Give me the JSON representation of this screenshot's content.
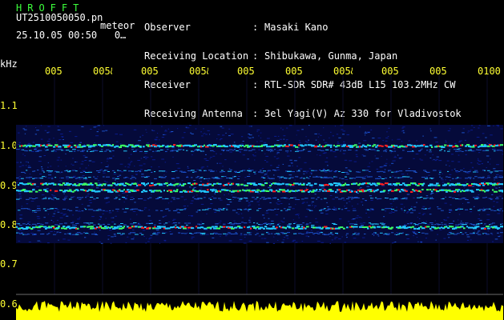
{
  "header": {
    "brand": "HROFFT",
    "file": "UT2510050050.pn",
    "tag": "meteor",
    "datetime": "25.10.05 00:50   0…",
    "info": [
      {
        "label": "Observer",
        "value": "Masaki Kano"
      },
      {
        "label": "Receiving Location",
        "value": "Shibukawa, Gunma, Japan"
      },
      {
        "label": "Receiver",
        "value": "RTL-SDR SDR# 43dB L15 103.2MHz CW"
      },
      {
        "label": "Receiving Antenna",
        "value": "3el Yagi(V) Az 330 for Vladivostok"
      }
    ],
    "separator": ":"
  },
  "axes": {
    "y_unit": "kHz",
    "x_ticks": [
      "005",
      "005&",
      "005;",
      "005&",
      "005!",
      "005(",
      "005&",
      "005(",
      "005;",
      "0100"
    ],
    "y_ticks": [
      "1.1",
      "1.0",
      "0.9",
      "0.8",
      "0.7",
      "0.6"
    ]
  },
  "colors": {
    "background": "#000000",
    "text_green": "#3cff3c",
    "text_white": "#ffffff",
    "axis_yellow": "#ffff33",
    "signal_low": "#0a1c8c",
    "signal_mid": "#22c8ff",
    "signal_hot": "#ff2020",
    "level_bar": "#ffff00"
  }
}
